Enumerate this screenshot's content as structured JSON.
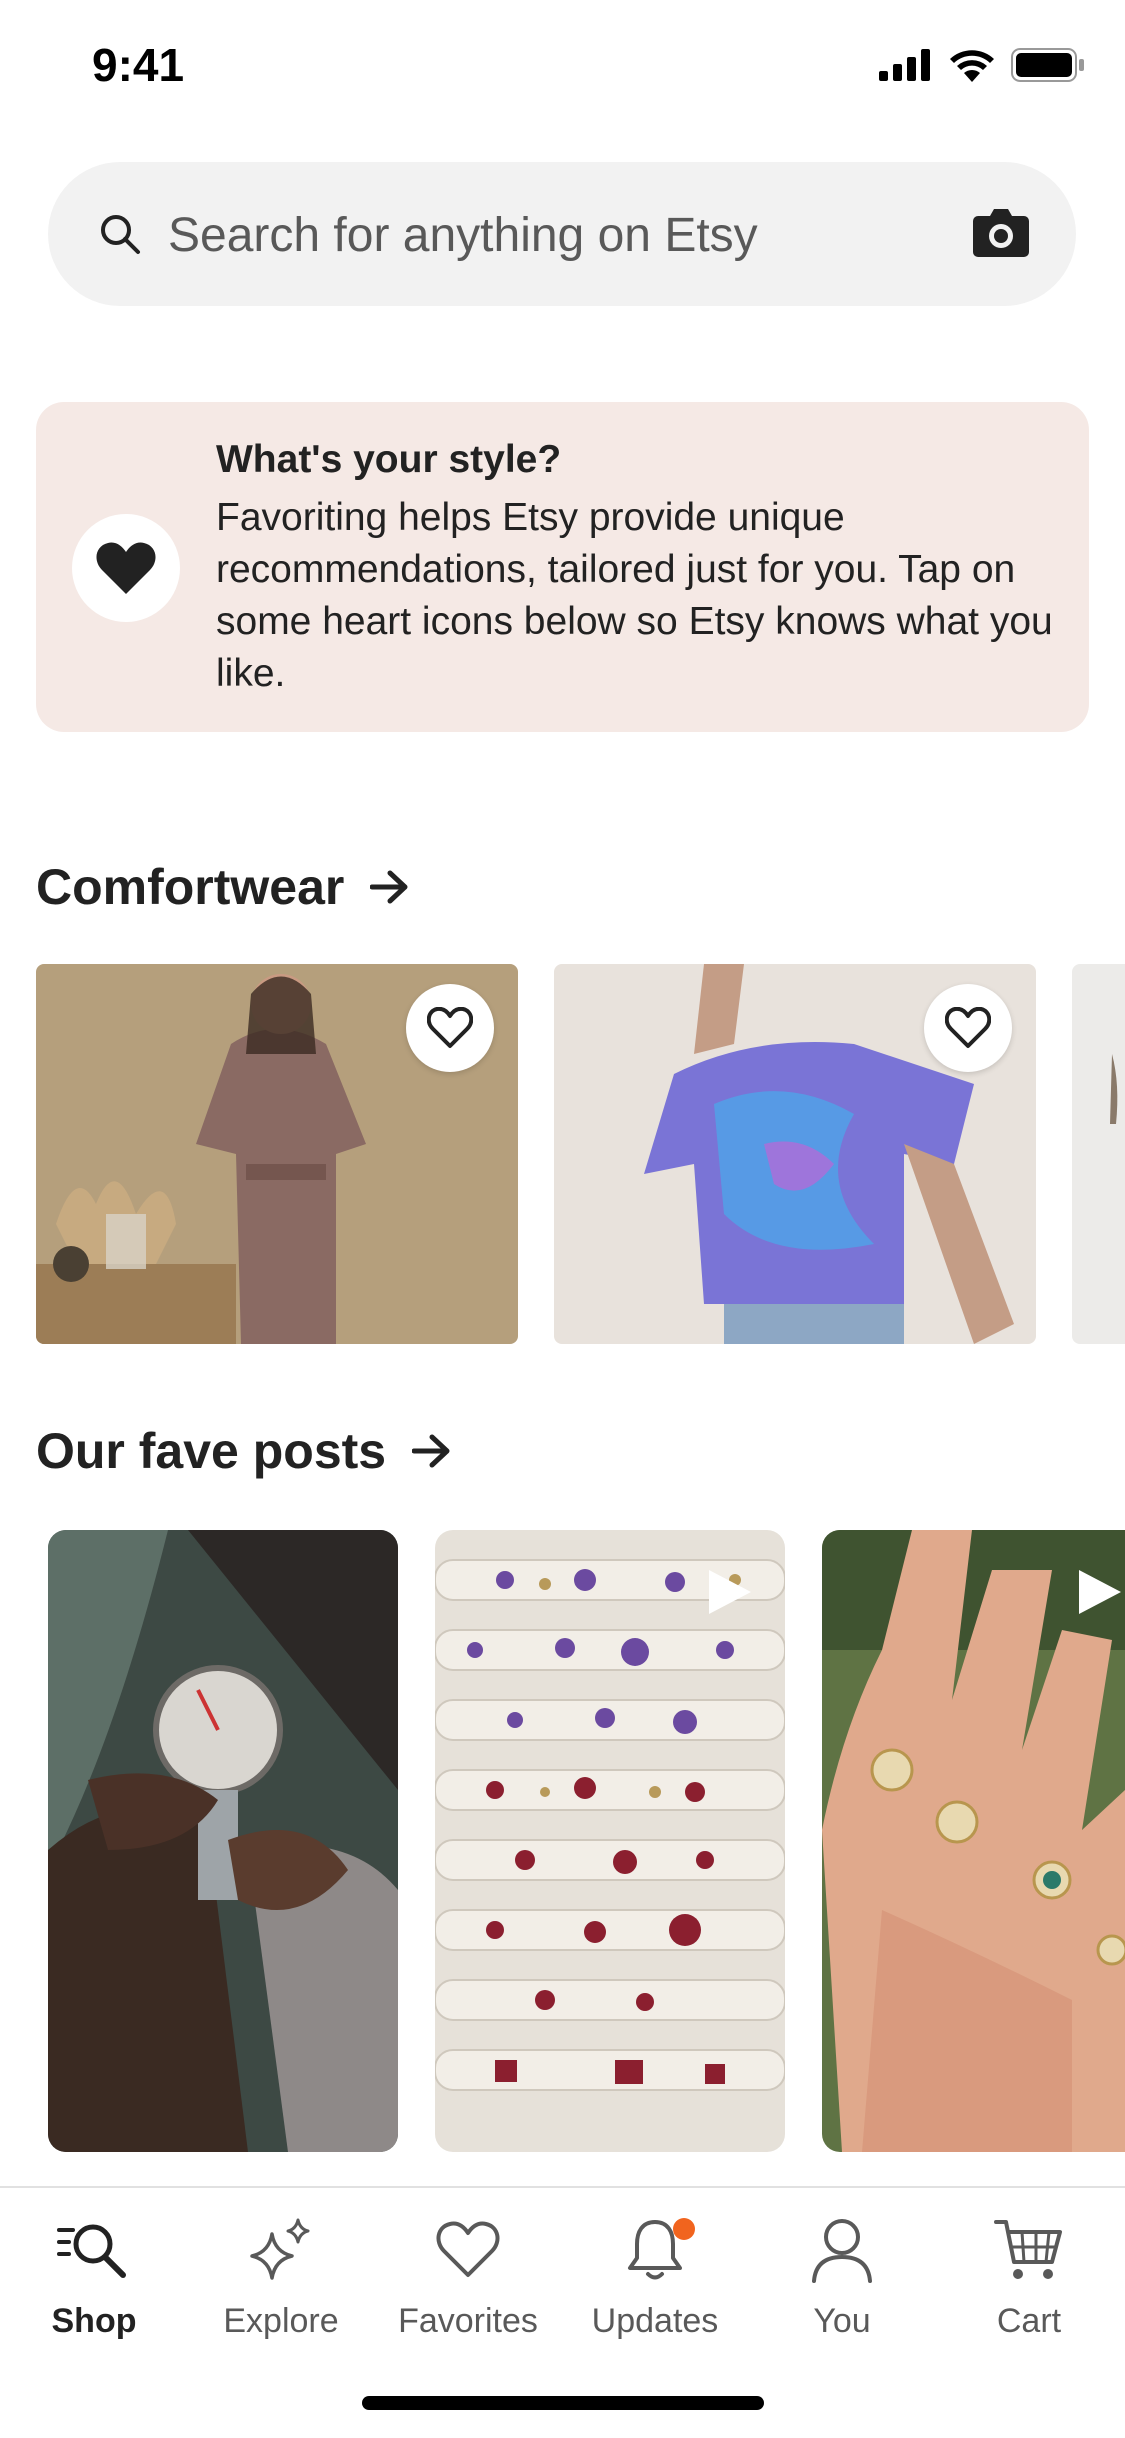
{
  "status": {
    "time": "9:41"
  },
  "search": {
    "placeholder": "Search for anything on Etsy"
  },
  "banner": {
    "title": "What's your style?",
    "body": "Favoriting helps Etsy provide unique recommendations, tailored just for you. Tap on some heart icons below so Etsy knows what you like."
  },
  "sections": {
    "comfortwear": {
      "title": "Comfortwear"
    },
    "fave_posts": {
      "title": "Our fave posts"
    }
  },
  "icons": {
    "search": "search-icon",
    "camera": "camera-icon",
    "heart": "heart-icon",
    "arrow": "arrow-right-icon",
    "play": "play-icon"
  },
  "colors": {
    "accent": "#f1641e",
    "banner_bg": "#f5e9e5",
    "search_bg": "#f2f2f2"
  },
  "tabs": [
    {
      "label": "Shop",
      "icon": "shop-search-icon",
      "active": true
    },
    {
      "label": "Explore",
      "icon": "sparkle-icon",
      "active": false
    },
    {
      "label": "Favorites",
      "icon": "heart-outline-icon",
      "active": false
    },
    {
      "label": "Updates",
      "icon": "bell-icon",
      "active": false,
      "has_badge": true
    },
    {
      "label": "You",
      "icon": "person-icon",
      "active": false
    },
    {
      "label": "Cart",
      "icon": "cart-icon",
      "active": false
    }
  ]
}
